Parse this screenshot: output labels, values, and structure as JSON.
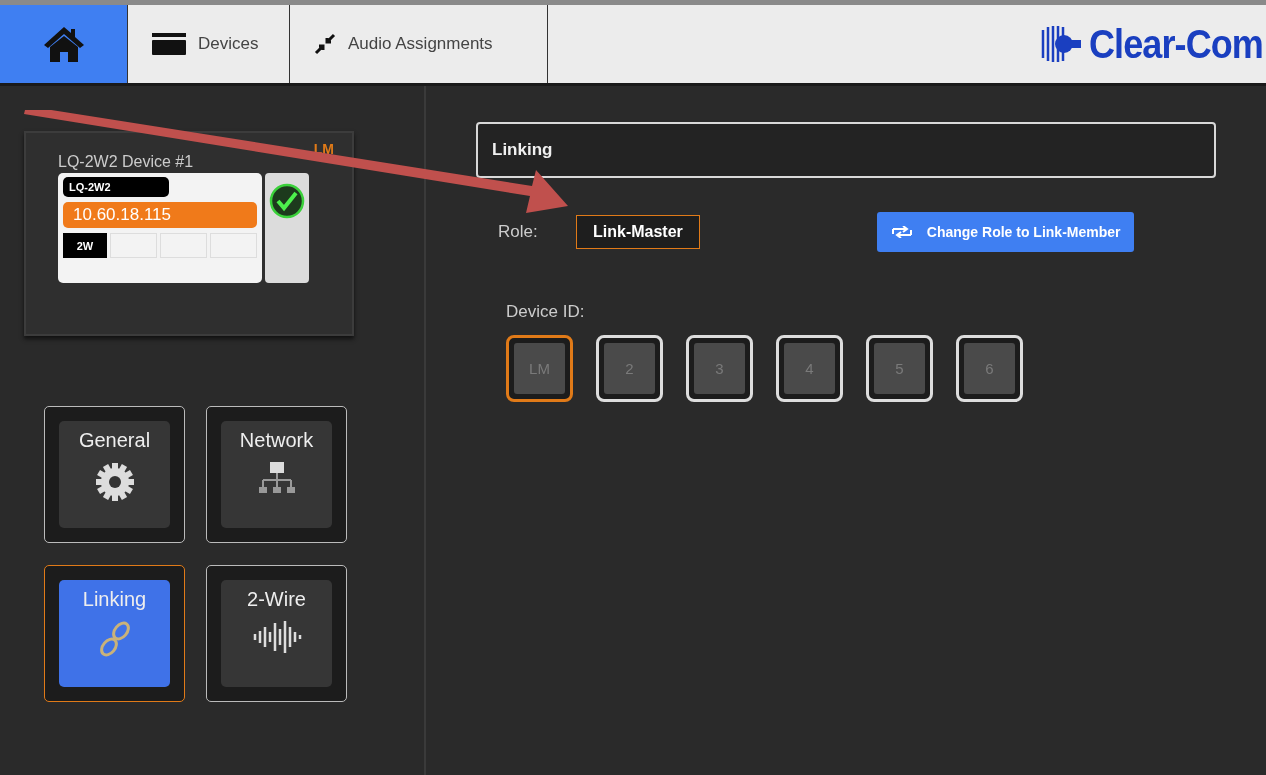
{
  "top_nav": {
    "tabs": [
      {
        "kind": "home",
        "selected": true
      },
      {
        "kind": "devices",
        "label": "Devices",
        "selected": false
      },
      {
        "kind": "audio",
        "label": "Audio Assignments",
        "selected": false
      }
    ],
    "logo": "Clear-Com"
  },
  "device_card": {
    "title": "LQ-2W2 Device #1",
    "role_badge": "LM",
    "model": "LQ-2W2",
    "ip": "10.60.18.115",
    "port": "2W",
    "online": true
  },
  "settings_tiles": [
    {
      "kind": "general",
      "label": "General",
      "selected": false
    },
    {
      "kind": "network",
      "label": "Network",
      "selected": false
    },
    {
      "kind": "linking",
      "label": "Linking",
      "selected": true
    },
    {
      "kind": "wire",
      "label": "2-Wire",
      "selected": false
    }
  ],
  "panel": {
    "title": "Linking",
    "role_label": "Role:",
    "role": "Link-Master",
    "change_button": "Change Role to Link-Member",
    "device_id_label": "Device ID:",
    "device_ids": [
      {
        "label": "LM",
        "selected": true
      },
      {
        "label": "2",
        "selected": false
      },
      {
        "label": "3",
        "selected": false
      },
      {
        "label": "4",
        "selected": false
      },
      {
        "label": "5",
        "selected": false
      },
      {
        "label": "6",
        "selected": false
      }
    ]
  }
}
